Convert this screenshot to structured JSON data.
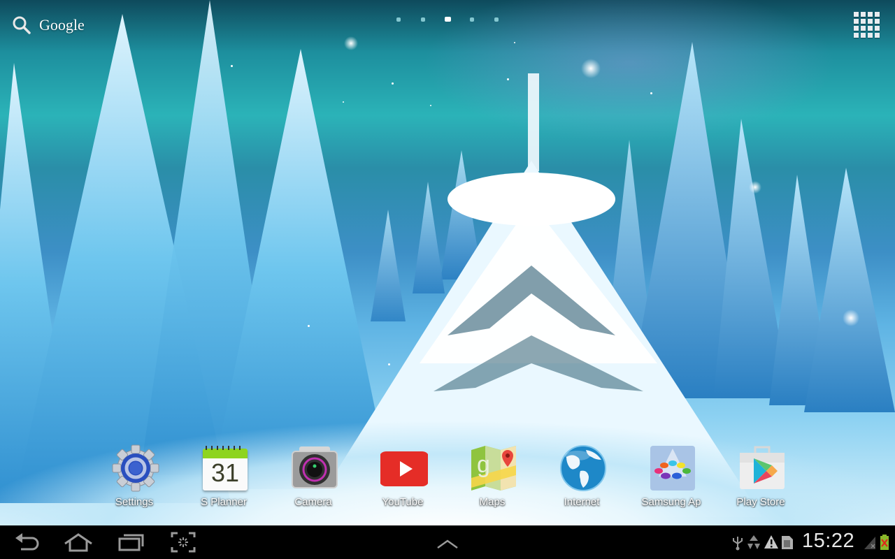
{
  "search": {
    "label": "Google",
    "icon": "search-icon"
  },
  "pager": {
    "pages": 5,
    "active_index": 2
  },
  "apps_button": {
    "icon": "apps-grid-icon"
  },
  "dock": {
    "apps": [
      {
        "label": "Settings",
        "icon": "settings-gear-icon"
      },
      {
        "label": "S Planner",
        "icon": "calendar-icon",
        "calendar_day": "31"
      },
      {
        "label": "Camera",
        "icon": "camera-icon"
      },
      {
        "label": "YouTube",
        "icon": "youtube-play-icon"
      },
      {
        "label": "Maps",
        "icon": "maps-icon"
      },
      {
        "label": "Internet",
        "icon": "globe-icon"
      },
      {
        "label": "Samsung Ap",
        "icon": "samsung-apps-icon"
      },
      {
        "label": "Play Store",
        "icon": "play-store-bag-icon"
      }
    ]
  },
  "navbar": {
    "buttons": [
      {
        "name": "back",
        "icon": "back-arrow-icon"
      },
      {
        "name": "home",
        "icon": "home-icon"
      },
      {
        "name": "recent-apps",
        "icon": "recent-apps-icon"
      },
      {
        "name": "screenshot",
        "icon": "screen-capture-icon"
      },
      {
        "name": "expand",
        "icon": "chevron-up-icon"
      }
    ],
    "status": {
      "time": "15:22",
      "icons": [
        "usb-icon",
        "recycle-icon",
        "warning-icon",
        "sd-card-icon",
        "signal-no-service-icon",
        "battery-charging-error-icon"
      ]
    }
  },
  "colors": {
    "sky_top": "#0e4a5c",
    "sky_mid": "#2bb3b8",
    "snow": "#e8f7fd",
    "navbar_bg": "#000000",
    "nav_icon": "#9a9a9a",
    "youtube_red": "#e52d27",
    "planner_green": "#8ed41f"
  }
}
